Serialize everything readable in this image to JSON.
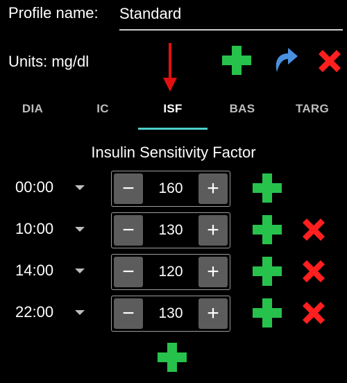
{
  "profile": {
    "name_label": "Profile name:",
    "name_value": "Standard"
  },
  "units": {
    "label": "Units: mg/dl"
  },
  "toolbar": {
    "add_icon": "plus-icon",
    "undo_icon": "undo-icon",
    "delete_icon": "close-icon",
    "colors": {
      "add": "#27c24c",
      "undo": "#4a90e2",
      "delete": "#ff1f1f"
    }
  },
  "annotation": {
    "arrow_color": "#e01010"
  },
  "tabs": [
    {
      "label": "DIA"
    },
    {
      "label": "IC"
    },
    {
      "label": "ISF",
      "active": true
    },
    {
      "label": "BAS"
    },
    {
      "label": "TARG"
    }
  ],
  "section": {
    "title": "Insulin Sensitivity Factor"
  },
  "rows": [
    {
      "time": "00:00",
      "value": "160",
      "minus": "−",
      "plus": "+",
      "deletable": false
    },
    {
      "time": "10:00",
      "value": "130",
      "minus": "−",
      "plus": "+",
      "deletable": true
    },
    {
      "time": "14:00",
      "value": "120",
      "minus": "−",
      "plus": "+",
      "deletable": true
    },
    {
      "time": "22:00",
      "value": "130",
      "minus": "−",
      "plus": "+",
      "deletable": true
    }
  ],
  "footer": {
    "add_icon": "plus-icon"
  }
}
